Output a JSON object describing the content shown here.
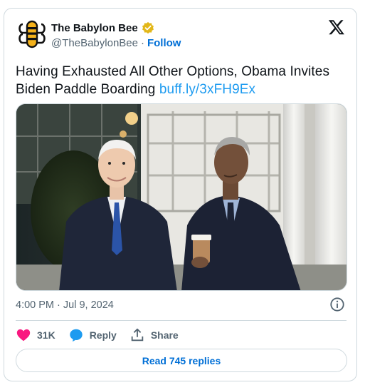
{
  "author": {
    "display_name": "The Babylon Bee",
    "handle": "@TheBabylonBee",
    "separator": "·",
    "follow_label": "Follow"
  },
  "tweet": {
    "text": "Having Exhausted All Other Options, Obama Invites Biden Paddle Boarding",
    "link": "buff.ly/3xFH9Ex"
  },
  "meta": {
    "timestamp": "4:00 PM · Jul 9, 2024"
  },
  "actions": {
    "like_count": "31K",
    "reply_label": "Reply",
    "share_label": "Share"
  },
  "read_replies_label": "Read 745 replies",
  "colors": {
    "like": "#f91880",
    "reply": "#1d9bf0",
    "link": "#1d9bf0",
    "follow": "#006fd6",
    "verified": "#e2b719"
  },
  "icons": {
    "avatar": "bee-logo-icon",
    "verified": "gold-verified-badge-icon",
    "brand": "x-logo-icon",
    "info": "info-icon",
    "like": "heart-icon",
    "reply": "speech-bubble-icon",
    "share": "share-upload-icon"
  }
}
